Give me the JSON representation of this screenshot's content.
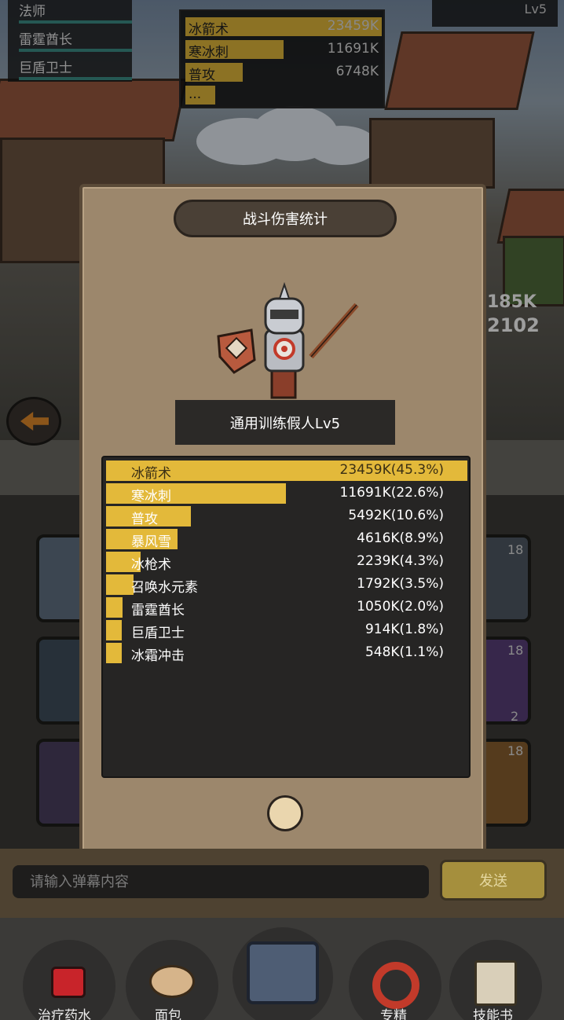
{
  "top_left_list": {
    "items": [
      "法师",
      "雷霆酋长",
      "巨盾卫士"
    ]
  },
  "top_dps_panel": {
    "rows": [
      {
        "name": "冰箭术",
        "value": "23459K",
        "fill": 1.0
      },
      {
        "name": "寒冰刺",
        "value": "11691K",
        "fill": 0.5
      },
      {
        "name": "普攻",
        "value": "6748K",
        "fill": 0.29
      },
      {
        "name": "...",
        "value": "",
        "fill": 0.15
      }
    ]
  },
  "top_right_level": "Lv5",
  "modal": {
    "title": "战斗伤害统计",
    "target_name": "通用训练假人Lv5",
    "stats": [
      {
        "name": "冰箭术",
        "value": "23459K(45.3%)",
        "fraction": 1.0
      },
      {
        "name": "寒冰刺",
        "value": "11691K(22.6%)",
        "fraction": 0.498
      },
      {
        "name": "普攻",
        "value": "5492K(10.6%)",
        "fraction": 0.234
      },
      {
        "name": "暴风雪",
        "value": "4616K(8.9%)",
        "fraction": 0.197
      },
      {
        "name": "冰枪术",
        "value": "2239K(4.3%)",
        "fraction": 0.095
      },
      {
        "name": "召唤水元素",
        "value": "1792K(3.5%)",
        "fraction": 0.076
      },
      {
        "name": "雷霆酋长",
        "value": "1050K(2.0%)",
        "fraction": 0.045
      },
      {
        "name": "巨盾卫士",
        "value": "914K(1.8%)",
        "fraction": 0.039
      },
      {
        "name": "冰霜冲击",
        "value": "548K(1.1%)",
        "fraction": 0.023
      }
    ]
  },
  "card_levels": {
    "right_1": "18",
    "right_2": "18",
    "right_2_count": "2",
    "right_3": "18"
  },
  "chat": {
    "placeholder": "请输入弹幕内容",
    "send_label": "发送"
  },
  "nav": {
    "items": [
      "治疗药水",
      "面包",
      "",
      "专精",
      "技能书"
    ]
  },
  "colors": {
    "accent": "#e3b93a",
    "panel": "#262524",
    "modal_bg": "#9c876c"
  }
}
